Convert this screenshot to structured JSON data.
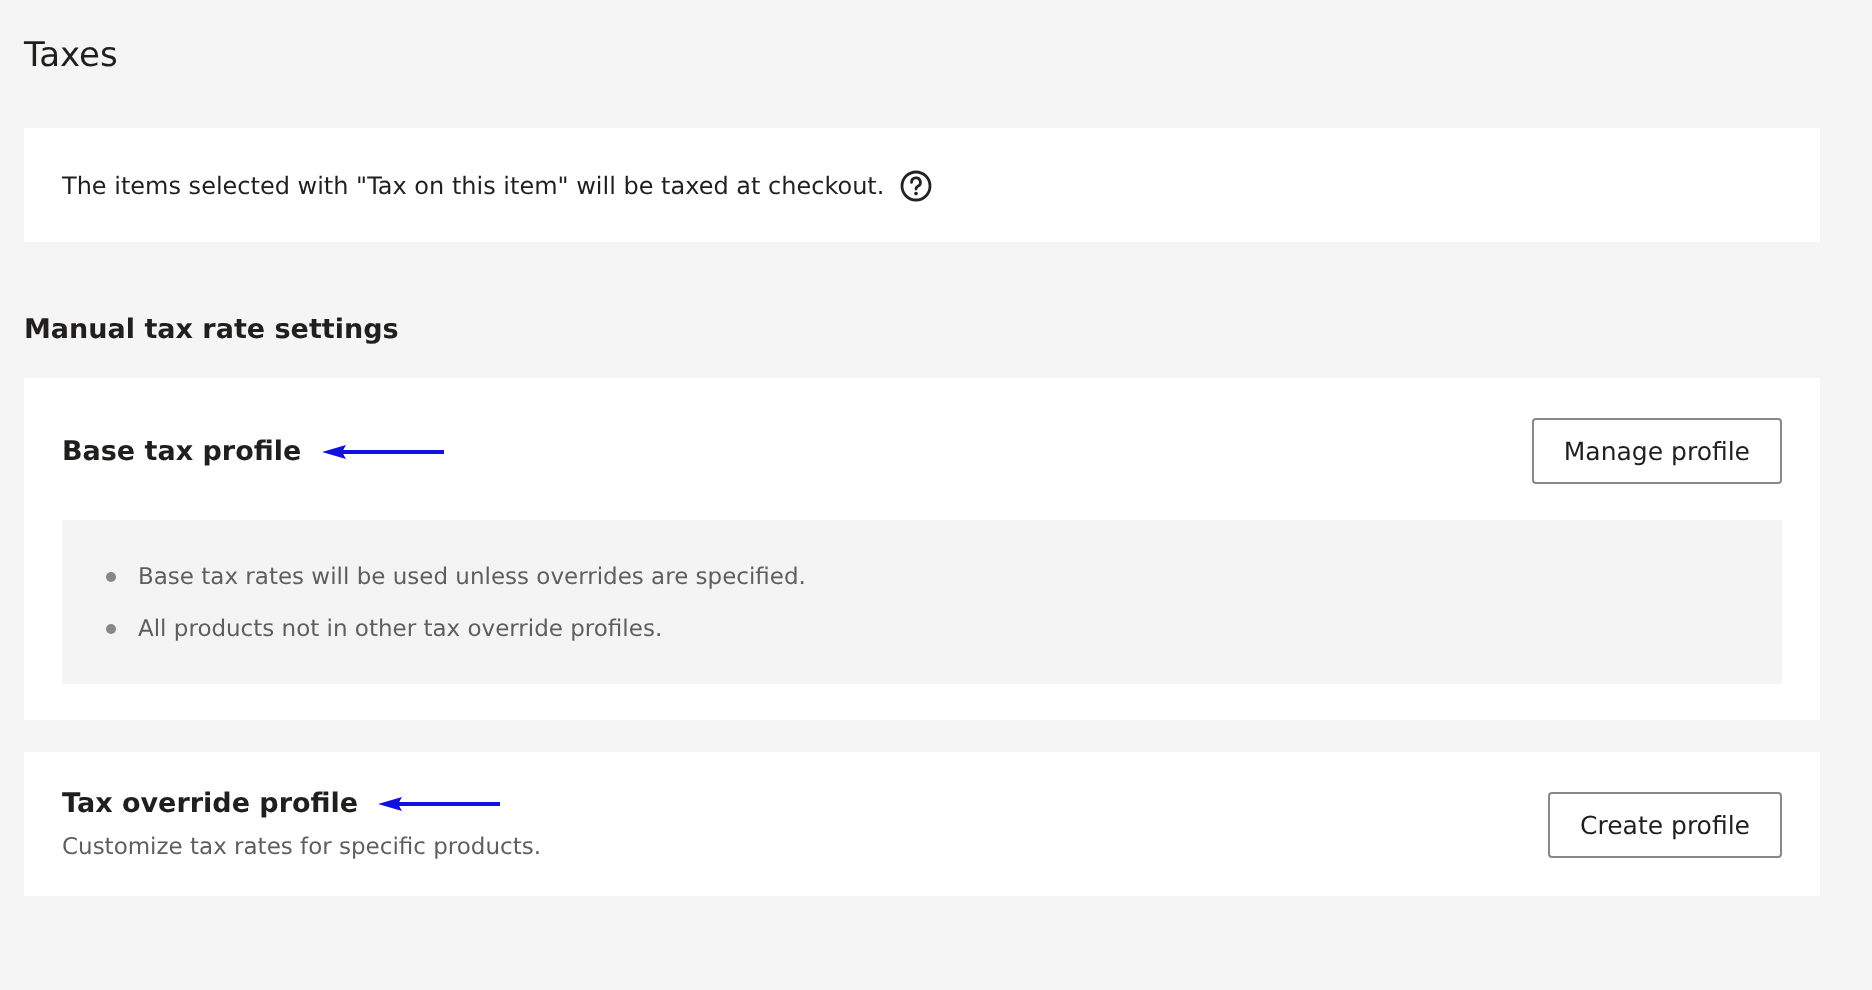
{
  "page": {
    "title": "Taxes"
  },
  "notice": {
    "text": "The items selected with \"Tax on this item\" will be taxed at checkout."
  },
  "section": {
    "title": "Manual tax rate settings"
  },
  "profiles": [
    {
      "kind": "bullets",
      "title": "Base tax profile",
      "button": "Manage profile",
      "bullets": [
        "Base tax rates will be used unless overrides are specified.",
        "All products not in other tax override profiles."
      ]
    },
    {
      "kind": "description",
      "title": "Tax override profile",
      "button": "Create profile",
      "description": "Customize tax rates for specific products."
    }
  ]
}
